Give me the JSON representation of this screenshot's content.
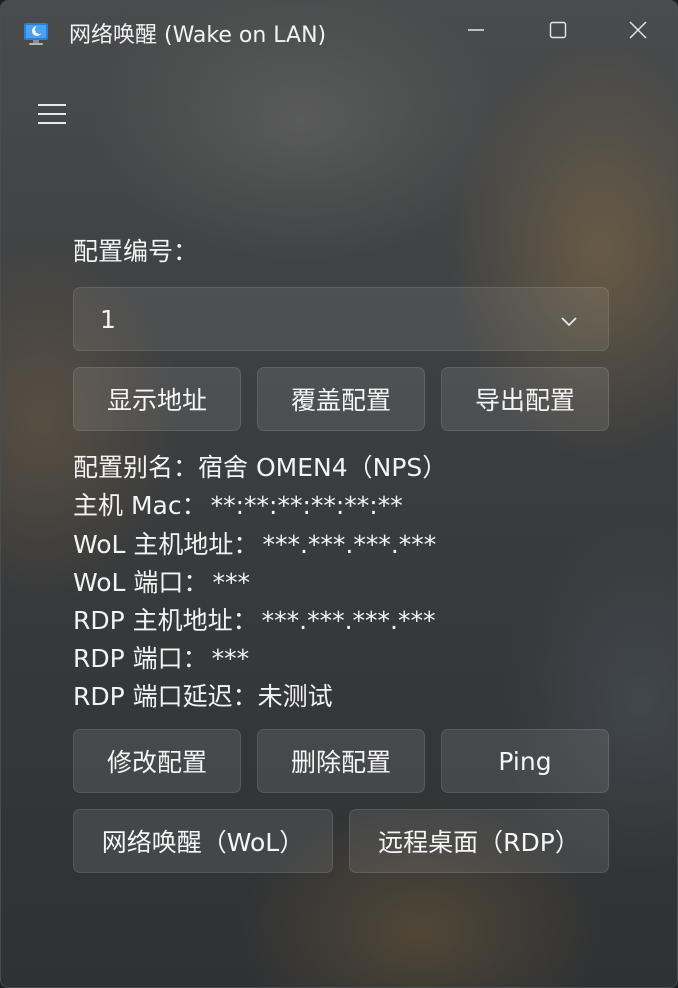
{
  "window": {
    "title": "网络唤醒 (Wake on LAN)",
    "controls": {
      "minimize": "minimize-icon",
      "maximize": "maximize-icon",
      "close": "close-icon"
    }
  },
  "menu": {
    "icon": "hamburger-menu-icon"
  },
  "config": {
    "number_label": "配置编号：",
    "selected_number": "1"
  },
  "top_buttons": {
    "show_address": "显示地址",
    "overwrite": "覆盖配置",
    "export": "导出配置"
  },
  "info": {
    "alias_label": "配置别名：",
    "alias_value": "宿舍 OMEN4（NPS）",
    "mac_label": "主机 Mac：",
    "mac_value": "**:**:**:**:**:**",
    "wol_host_label": "WoL 主机地址：",
    "wol_host_value": "***.***.***.***",
    "wol_port_label": "WoL 端口：",
    "wol_port_value": "***",
    "rdp_host_label": "RDP 主机地址：",
    "rdp_host_value": "***.***.***.***",
    "rdp_port_label": "RDP 端口：",
    "rdp_port_value": "***",
    "rdp_latency_label": "RDP 端口延迟：",
    "rdp_latency_value": "未测试"
  },
  "bottom_buttons": {
    "modify": "修改配置",
    "delete": "删除配置",
    "ping": "Ping",
    "wol": "网络唤醒（WoL）",
    "rdp": "远程桌面（RDP）"
  }
}
